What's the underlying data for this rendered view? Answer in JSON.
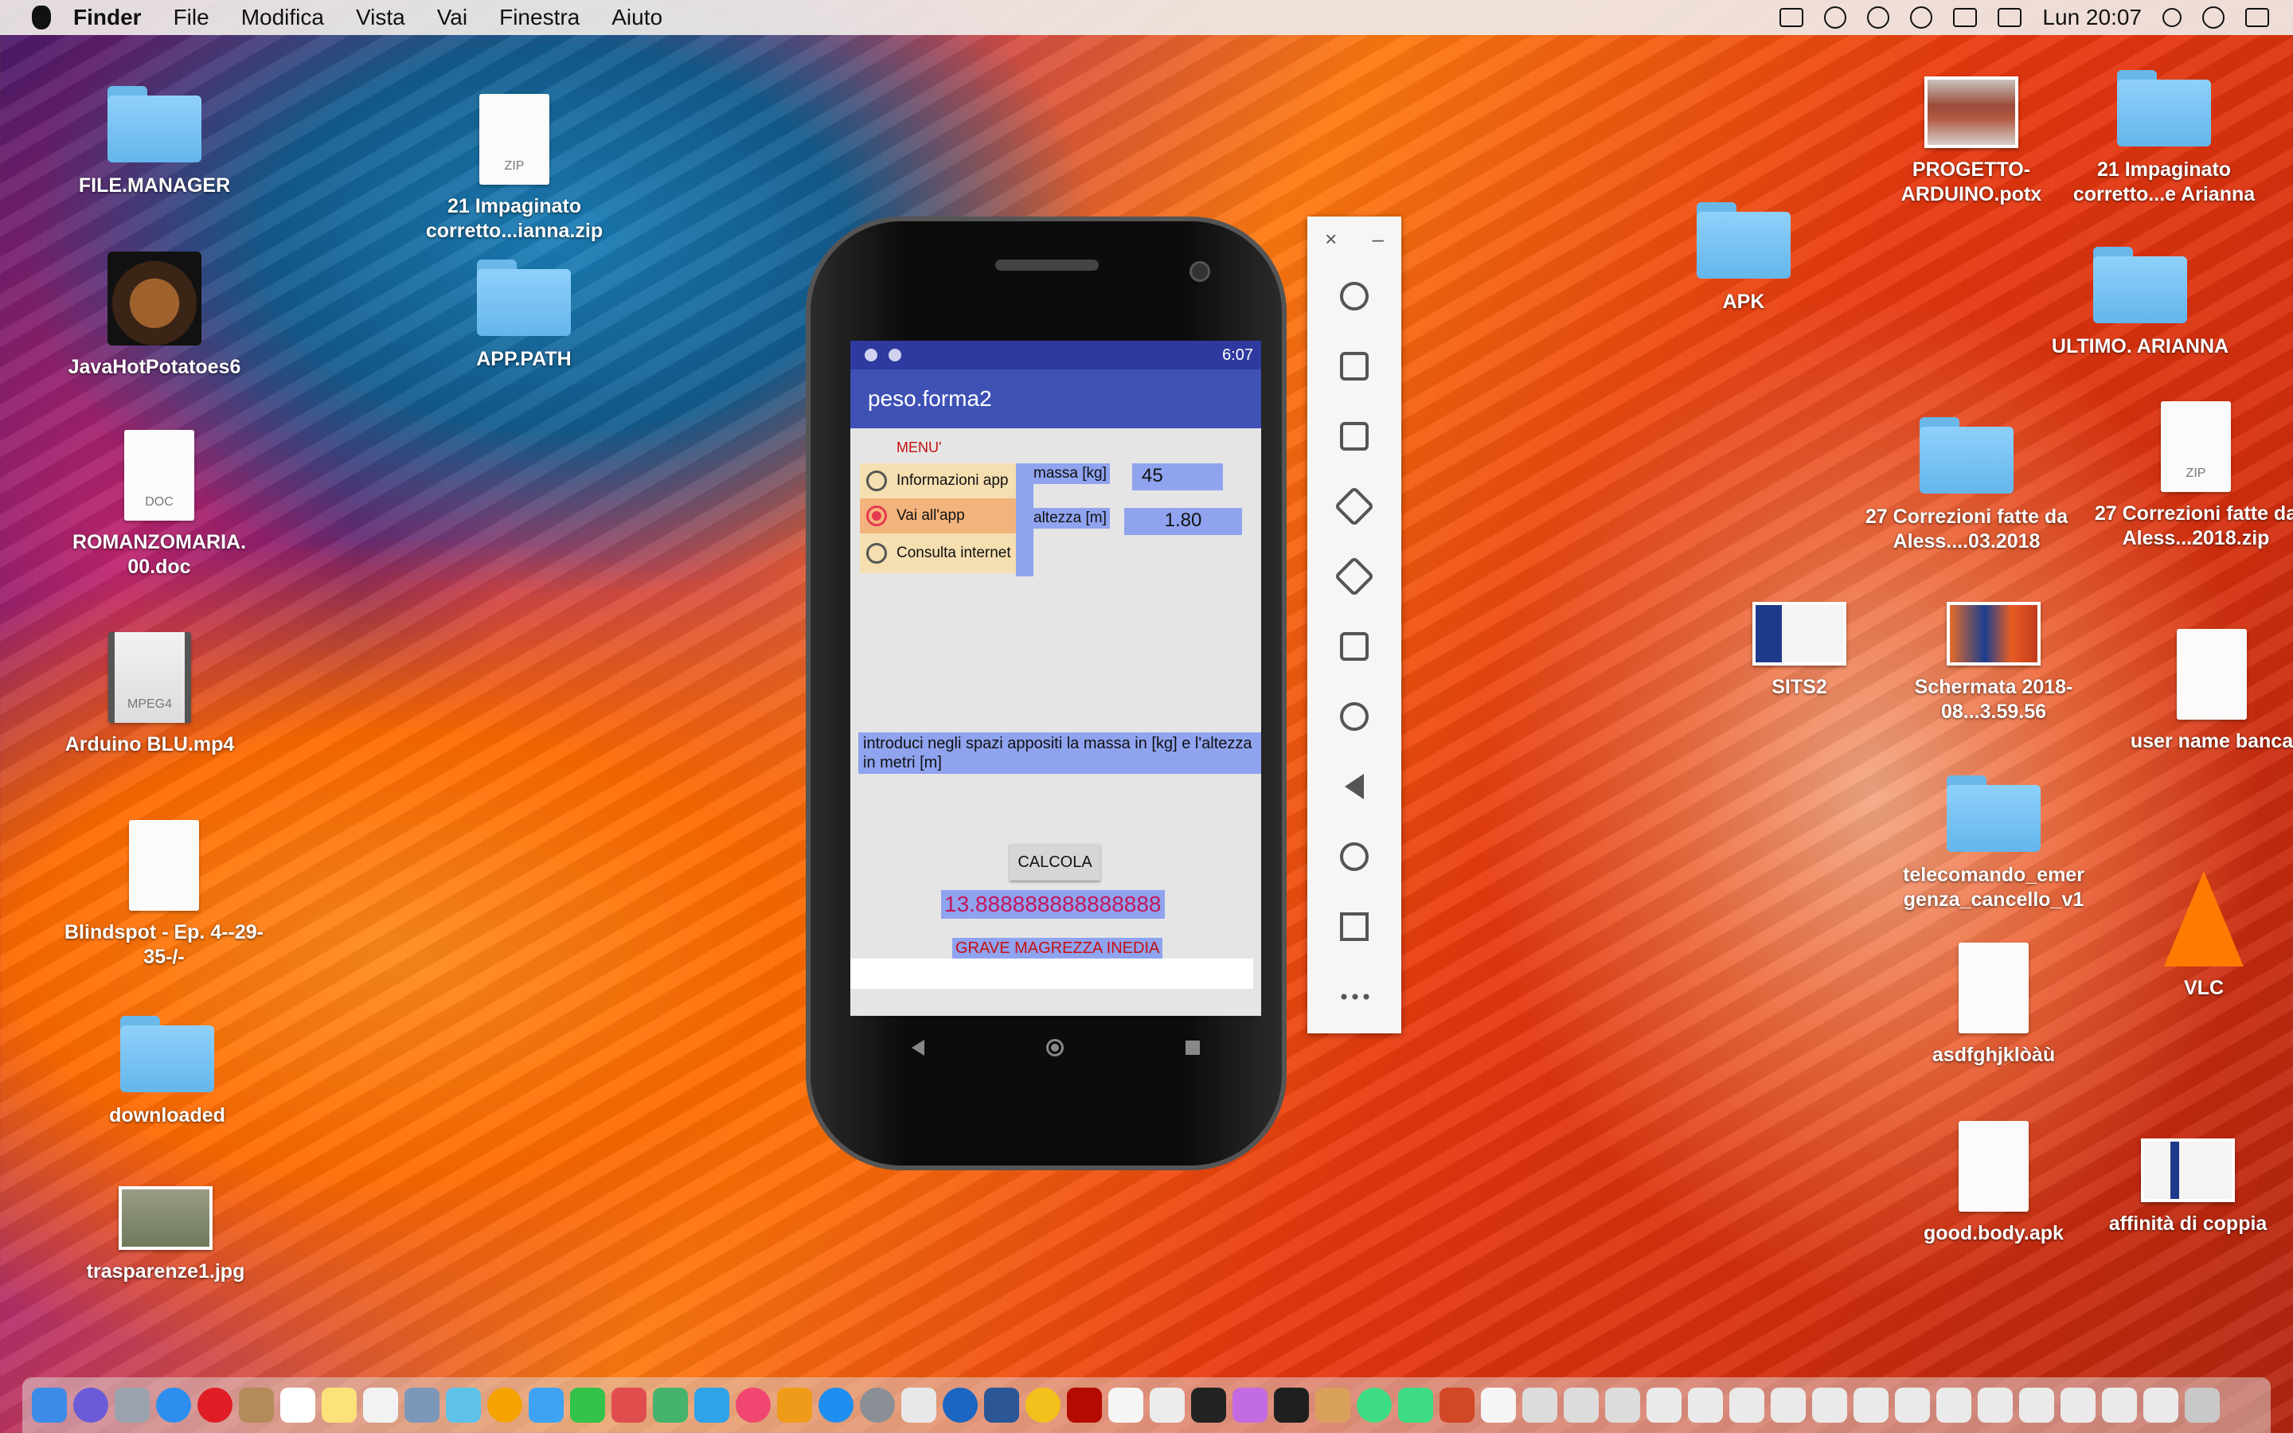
{
  "menubar": {
    "app": "Finder",
    "items": [
      "File",
      "Modifica",
      "Vista",
      "Vai",
      "Finestra",
      "Aiuto"
    ],
    "clock": "Lun 20:07",
    "status_icons": [
      "mail-icon",
      "sync-icon",
      "bluetooth-icon",
      "wifi-icon",
      "volume-icon",
      "battery-icon",
      "search-icon",
      "siri-icon",
      "list-icon"
    ]
  },
  "desktop": {
    "icons": [
      {
        "label": "FILE.MANAGER",
        "kind": "folder"
      },
      {
        "label": "21 Impaginato corretto...ianna.zip",
        "kind": "zip",
        "badge": "ZIP"
      },
      {
        "label": "JavaHotPotatoes6",
        "kind": "app"
      },
      {
        "label": "APP.PATH",
        "kind": "folder"
      },
      {
        "label": "ROMANZOMARIA. 00.doc",
        "kind": "doc",
        "badge": "DOC"
      },
      {
        "label": "Arduino BLU.mp4",
        "kind": "video",
        "badge": "MPEG4"
      },
      {
        "label": "Blindspot - Ep. 4--29-35-/-",
        "kind": "doc"
      },
      {
        "label": "downloaded",
        "kind": "folder"
      },
      {
        "label": "trasparenze1.jpg",
        "kind": "image"
      },
      {
        "label": "PROGETTO- ARDUINO.potx",
        "kind": "image"
      },
      {
        "label": "21 Impaginato corretto...e Arianna",
        "kind": "folder"
      },
      {
        "label": "APK",
        "kind": "folder"
      },
      {
        "label": "ULTIMO. ARIANNA",
        "kind": "folder"
      },
      {
        "label": "27 Correzioni fatte da Aless....03.2018",
        "kind": "folder"
      },
      {
        "label": "27 Correzioni fatte da Aless...2018.zip",
        "kind": "zip",
        "badge": "ZIP"
      },
      {
        "label": "SITS2",
        "kind": "image"
      },
      {
        "label": "Schermata 2018-08...3.59.56",
        "kind": "image"
      },
      {
        "label": "user name banca",
        "kind": "doc"
      },
      {
        "label": "telecomando_emer genza_cancello_v1",
        "kind": "folder"
      },
      {
        "label": "VLC",
        "kind": "app"
      },
      {
        "label": "asdfghjklòàù",
        "kind": "doc"
      },
      {
        "label": "good.body.apk",
        "kind": "doc"
      },
      {
        "label": "affinità di coppia",
        "kind": "image"
      }
    ]
  },
  "phone": {
    "status_time": "6:07",
    "app_title": "peso.forma2",
    "menu_title": "MENU'",
    "radio_options": [
      {
        "label": "Informazioni app",
        "selected": false
      },
      {
        "label": "Vai all'app",
        "selected": true
      },
      {
        "label": "Consulta internet",
        "selected": false
      }
    ],
    "mass_label": "massa [kg]",
    "mass_value": "45",
    "height_label": "altezza [m]",
    "height_value": "1.80",
    "info_text": "introduci negli spazi appositi la massa in [kg] e l'altezza in metri [m]",
    "calc_button": "CALCOLA",
    "result": "13.888888888888888",
    "verdict": "GRAVE MAGREZZA INEDIA"
  },
  "emulator_toolbar": {
    "close": "×",
    "minimize": "–",
    "tools": [
      "power-icon",
      "volume-up-icon",
      "volume-down-icon",
      "rotate-left-icon",
      "rotate-right-icon",
      "camera-icon",
      "zoom-icon",
      "back-icon",
      "home-icon",
      "overview-icon",
      "more-icon"
    ]
  },
  "colors": {
    "app_bar": "#3f51b5",
    "status_bar": "#2e3a9f",
    "highlight": "#8fa3ef",
    "result_text": "#c2185b",
    "verdict_text": "#c51010"
  }
}
